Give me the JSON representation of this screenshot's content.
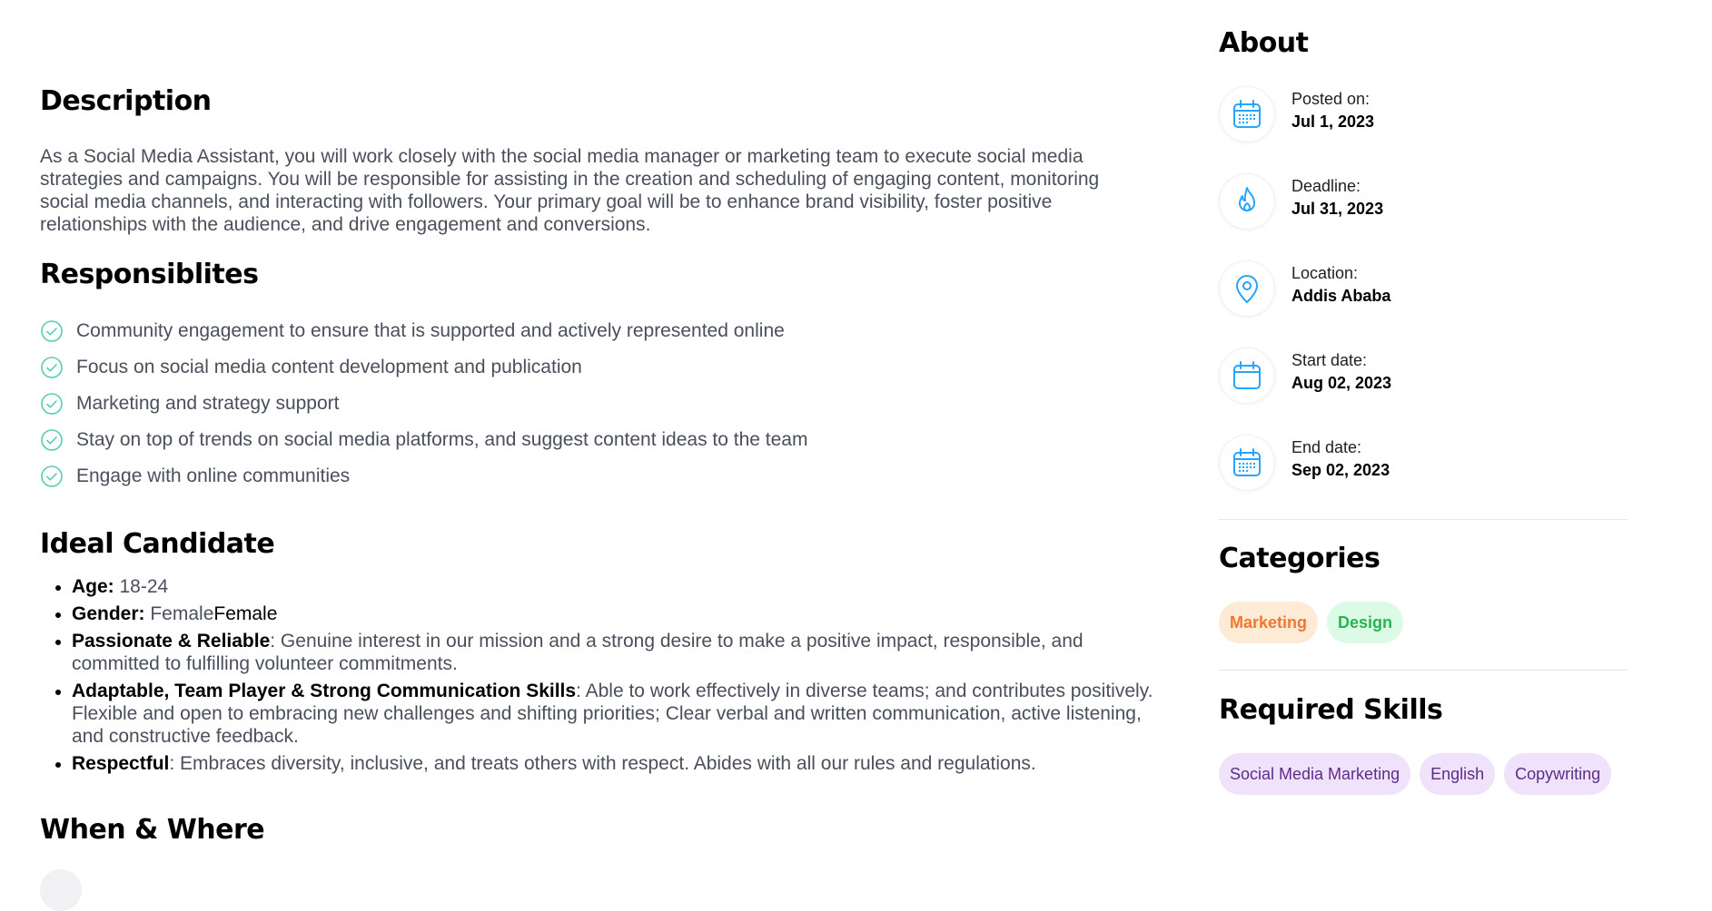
{
  "description": {
    "title": "Description",
    "text": "As a Social Media Assistant, you will work closely with the social media manager or marketing team to execute social media strategies and campaigns. You will be responsible for assisting in the creation and scheduling of engaging content, monitoring social media channels, and interacting with followers. Your primary goal will be to enhance brand visibility, foster positive relationships with the audience, and drive engagement and conversions."
  },
  "responsibilities": {
    "title": "Responsiblites",
    "items": [
      "Community engagement to ensure that is supported and actively represented online",
      "Focus on social media content development and publication",
      "Marketing and strategy support",
      "Stay on top of trends on social media platforms, and suggest content ideas to the team",
      "Engage with online communities"
    ],
    "icon": "check-circle-icon",
    "icon_color": "#56CDAD"
  },
  "ideal_candidate": {
    "title": "Ideal Candidate",
    "items": [
      {
        "label": "Age:",
        "text": " 18-24",
        "extra": ""
      },
      {
        "label": "Gender:",
        "text": " Female",
        "extra": "Female"
      },
      {
        "label": "Passionate & Reliable",
        "text": ": Genuine interest in our mission and a strong desire to make a positive impact, responsible, and committed to fulfilling volunteer commitments.",
        "extra": ""
      },
      {
        "label": "Adaptable, Team Player & Strong Communication Skills",
        "text": ": Able to work effectively in diverse teams; and contributes positively. Flexible and open to embracing new challenges and shifting priorities; Clear verbal and written communication, active listening, and constructive feedback.",
        "extra": ""
      },
      {
        "label": "Respectful",
        "text": ": Embraces diversity, inclusive, and treats others with respect. Abides with all our rules and regulations.",
        "extra": ""
      }
    ]
  },
  "when_where": {
    "title": "When & Where"
  },
  "about": {
    "title": "About",
    "items": [
      {
        "label": "Posted on:",
        "value": "Jul 1, 2023",
        "icon": "calendar-grid-icon"
      },
      {
        "label": "Deadline:",
        "value": "Jul 31, 2023",
        "icon": "fire-icon"
      },
      {
        "label": "Location:",
        "value": "Addis Ababa",
        "icon": "location-pin-icon"
      },
      {
        "label": "Start date:",
        "value": "Aug 02, 2023",
        "icon": "calendar-icon"
      },
      {
        "label": "End date:",
        "value": "Sep 02, 2023",
        "icon": "calendar-grid-icon"
      }
    ],
    "icon_color": "#26A4FF"
  },
  "categories": {
    "title": "Categories",
    "items": [
      "Marketing",
      "Design"
    ]
  },
  "required_skills": {
    "title": "Required Skills",
    "items": [
      "Social Media Marketing",
      "English",
      "Copywriting"
    ]
  }
}
